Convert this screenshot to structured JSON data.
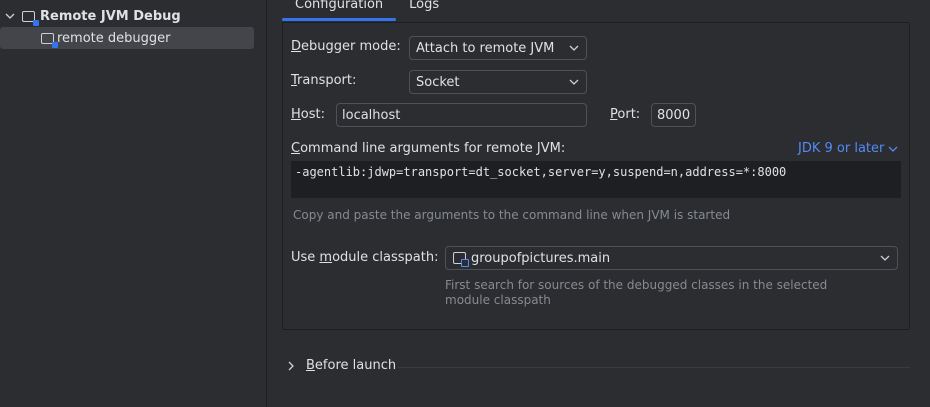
{
  "sidebar": {
    "group_label": "Remote JVM Debug",
    "item_label": "remote debugger",
    "icons": {
      "expand": "chevron-down-icon",
      "config": "run-config-icon"
    }
  },
  "tabs": [
    {
      "label": "Configuration",
      "active": true
    },
    {
      "label": "Logs",
      "active": false
    }
  ],
  "form": {
    "debugger_mode": {
      "label_mn": "D",
      "label_rest": "ebugger mode:",
      "value": "Attach to remote JVM"
    },
    "transport": {
      "label_mn": "T",
      "label_rest": "ransport:",
      "value": "Socket"
    },
    "host": {
      "label_mn": "H",
      "label_rest": "ost:",
      "value": "localhost"
    },
    "port": {
      "label_mn": "P",
      "label_rest": "ort:",
      "value": "8000"
    },
    "cmd": {
      "label_mn": "C",
      "label_rest": "ommand line arguments for remote JVM:",
      "jdk_link": "JDK 9 or later",
      "value": "-agentlib:jdwp=transport=dt_socket,server=y,suspend=n,address=*:8000",
      "hint": "Copy and paste the arguments to the command line when JVM is started"
    },
    "module": {
      "label_pre": "Use ",
      "label_mn": "m",
      "label_rest": "odule classpath:",
      "value": "groupofpictures.main",
      "hint_line1": "First search for sources of the debugged classes in the selected",
      "hint_line2": "module classpath"
    }
  },
  "before_launch": {
    "label_mn": "B",
    "label_rest": "efore launch"
  },
  "colors": {
    "accent": "#3574f0",
    "link": "#548af7",
    "background": "#2b2d30"
  }
}
